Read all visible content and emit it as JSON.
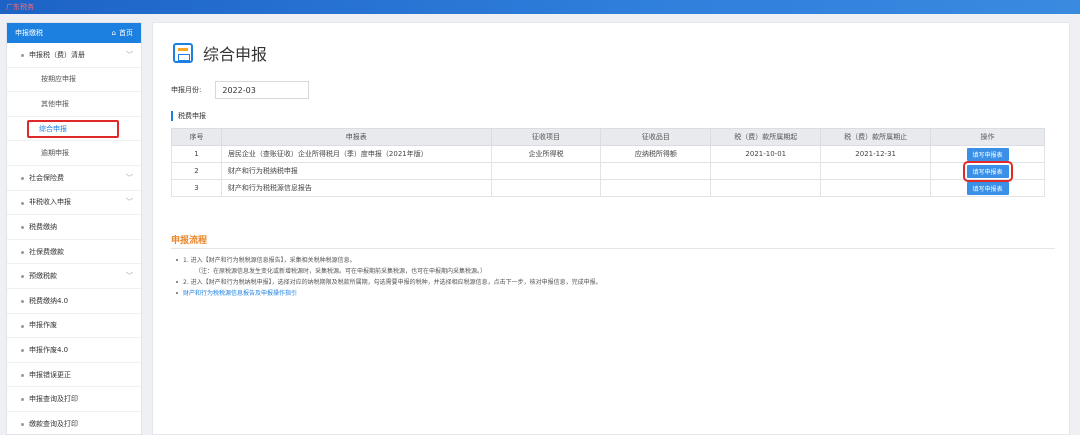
{
  "topbar": {
    "logo": "广东税务"
  },
  "sidebar": {
    "header": "申报缴税",
    "home": "首页",
    "items": [
      {
        "label": "申报税（费）清册",
        "chev": "﹀"
      },
      {
        "label": "按期应申报",
        "sub": true
      },
      {
        "label": "其他申报",
        "sub": true
      },
      {
        "label": "综合申报",
        "sub": true,
        "active": true
      },
      {
        "label": "逾期申报",
        "sub": true
      },
      {
        "label": "社会保险费",
        "chev": "﹀"
      },
      {
        "label": "非税收入申报",
        "chev": "﹀"
      },
      {
        "label": "税费缴纳"
      },
      {
        "label": "社保费缴款"
      },
      {
        "label": "预缴税款",
        "chev": "﹀"
      },
      {
        "label": "税费缴纳4.0"
      },
      {
        "label": "申报作废"
      },
      {
        "label": "申报作废4.0"
      },
      {
        "label": "申报错误更正"
      },
      {
        "label": "申报查询及打印"
      },
      {
        "label": "缴款查询及打印"
      }
    ]
  },
  "main": {
    "title": "综合申报",
    "month_label": "申报月份:",
    "month_value": "2022-03",
    "section": "税费申报",
    "columns": [
      "序号",
      "申报表",
      "征收项目",
      "征收品目",
      "税（费）款所属期起",
      "税（费）款所属期止",
      "操作"
    ],
    "rows": [
      {
        "no": "1",
        "form": "居民企业（查账征收）企业所得税月（季）度申报（2021年版）",
        "item": "企业所得税",
        "sub": "应纳税所得额",
        "start": "2021-10-01",
        "end": "2021-12-31",
        "action": "填写申报表"
      },
      {
        "no": "2",
        "form": "财产和行为税纳税申报",
        "item": "",
        "sub": "",
        "start": "",
        "end": "",
        "action": "填写申报表"
      },
      {
        "no": "3",
        "form": "财产和行为税税源信息报告",
        "item": "",
        "sub": "",
        "start": "",
        "end": "",
        "action": "填写申报表"
      }
    ],
    "flow_title": "申报流程",
    "flow": [
      "1. 进入【财产和行为税税源信息报告】，采集相关税种税源信息。",
      "（注：在原税源信息发生变化或新增税源时，采集税源。可在申报期前采集税源，也可在申报期内采集税源。）",
      "2. 进入【财产和行为税纳税申报】，选择对应的纳税期限及税款所属期，勾选需要申报的税种，并选择相应税源信息，点击下一步，核对申报信息，完成申报。",
      "财产和行为税税源信息报告及申报操作指引"
    ]
  }
}
